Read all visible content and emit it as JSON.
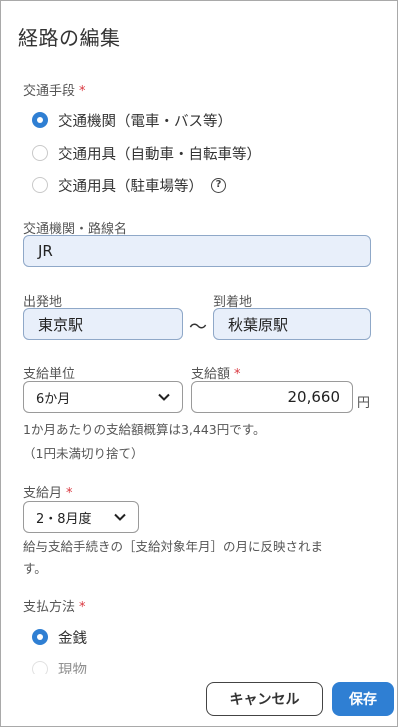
{
  "dialog": {
    "title": "経路の編集"
  },
  "transport": {
    "label": "交通手段",
    "required_mark": "*",
    "options": [
      {
        "label": "交通機関（電車・バス等）",
        "checked": true
      },
      {
        "label": "交通用具（自動車・自転車等）",
        "checked": false
      },
      {
        "label": "交通用具（駐車場等）",
        "checked": false
      }
    ],
    "help_icon": "?"
  },
  "route": {
    "label": "交通機関・路線名",
    "value": "JR"
  },
  "stations": {
    "departure_label": "出発地",
    "departure_value": "東京駅",
    "separator": "〜",
    "arrival_label": "到着地",
    "arrival_value": "秋葉原駅"
  },
  "payment": {
    "unit_label": "支給単位",
    "unit_value": "6か月",
    "amount_label": "支給額",
    "required_mark": "*",
    "amount_value": "20,660",
    "currency": "円",
    "note_line1": "1か月あたりの支給額概算は3,443円です。",
    "note_line2": "（1円未満切り捨て）"
  },
  "month": {
    "label": "支給月",
    "required_mark": "*",
    "value": "2・8月度",
    "note_line1": "給与支給手続きの［支給対象年月］の月に反映されま",
    "note_line2": "す。"
  },
  "method": {
    "label": "支払方法",
    "required_mark": "*",
    "options": [
      {
        "label": "金銭",
        "checked": true
      },
      {
        "label": "現物",
        "checked": false
      }
    ]
  },
  "footer": {
    "cancel_label": "キャンセル",
    "save_label": "保存"
  },
  "colors": {
    "accent": "#2f7fd3",
    "required": "#d9363e",
    "field_fill": "#e8effa"
  }
}
